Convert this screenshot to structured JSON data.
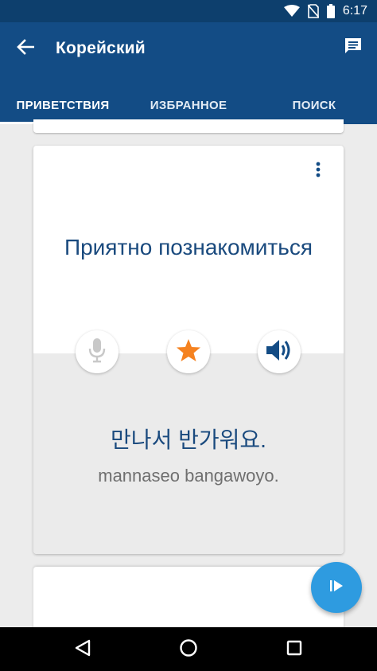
{
  "status_bar": {
    "time": "6:17",
    "icons": [
      "wifi-icon",
      "no-sim-icon",
      "battery-icon"
    ]
  },
  "app_bar": {
    "title": "Корейский",
    "back_icon": "arrow-left-icon",
    "action_icon": "chat-icon"
  },
  "tabs": [
    {
      "label": "ПРИВЕТСТВИЯ",
      "active": true
    },
    {
      "label": "ИЗБРАННОЕ",
      "active": false
    },
    {
      "label": "ПОИСК",
      "active": false
    }
  ],
  "card": {
    "phrase_ru": "Приятно познакомиться",
    "phrase_ko": "만나서 반가워요.",
    "transliteration": "mannaseo bangawoyo.",
    "menu_icon": "more-vert-icon",
    "buttons": [
      {
        "icon": "microphone-icon",
        "enabled": false
      },
      {
        "icon": "star-icon",
        "starred": true
      },
      {
        "icon": "speaker-icon"
      }
    ]
  },
  "fab": {
    "icon": "play-next-icon"
  },
  "nav_bar": {
    "icons": [
      "nav-back-icon",
      "nav-home-icon",
      "nav-recents-icon"
    ]
  },
  "colors": {
    "status_bar": "#0d3f6d",
    "app_bar": "#134c85",
    "phrase_text": "#1a4a7e",
    "star": "#f58220",
    "fab": "#2e9be0",
    "background": "#ececec"
  }
}
